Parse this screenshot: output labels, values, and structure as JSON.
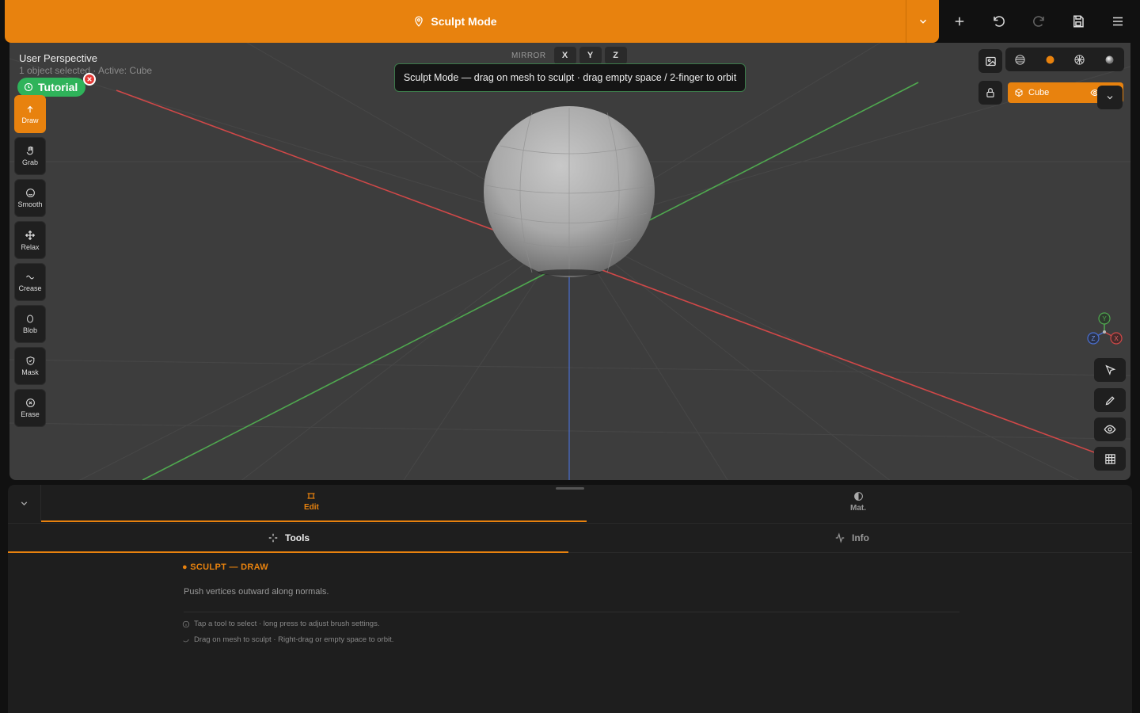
{
  "topbar": {
    "mode_label": "Sculpt Mode",
    "icons": [
      "chevron-down-icon",
      "plus-icon",
      "undo-icon",
      "redo-icon",
      "save-icon",
      "menu-icon"
    ]
  },
  "viewport": {
    "title": "User Perspective",
    "subtitle": "1 object selected · Active: Cube",
    "tutorial_label": "Tutorial",
    "toast": "Sculpt Mode — drag on mesh to sculpt · drag empty space / 2-finger to orbit",
    "mirror": {
      "label": "MIRROR",
      "axes": [
        "X",
        "Y",
        "Z"
      ]
    },
    "object_name": "Cube",
    "gizmo": {
      "y": "Y",
      "z": "Z",
      "x": "X"
    }
  },
  "tools": [
    {
      "label": "Draw",
      "icon": "arrow-up-icon",
      "active": true
    },
    {
      "label": "Grab",
      "icon": "hand-icon",
      "active": false
    },
    {
      "label": "Smooth",
      "icon": "smooth-icon",
      "active": false
    },
    {
      "label": "Relax",
      "icon": "move-icon",
      "active": false
    },
    {
      "label": "Crease",
      "icon": "wave-icon",
      "active": false
    },
    {
      "label": "Blob",
      "icon": "blob-icon",
      "active": false
    },
    {
      "label": "Mask",
      "icon": "shield-icon",
      "active": false
    },
    {
      "label": "Erase",
      "icon": "erase-icon",
      "active": false
    }
  ],
  "panel": {
    "tabs": [
      {
        "label": "Edit",
        "active": true
      },
      {
        "label": "Mat.",
        "active": false
      }
    ],
    "subtabs": [
      {
        "label": "Tools",
        "active": true
      },
      {
        "label": "Info",
        "active": false
      }
    ],
    "section_title": "● SCULPT — DRAW",
    "section_desc": "Push vertices outward along normals.",
    "hint1": "Tap a tool to select · long press to adjust brush settings.",
    "hint2": "Drag on mesh to sculpt · Right-drag or empty space to orbit."
  },
  "colors": {
    "accent": "#e8820e",
    "viewport_bg": "#3d3d3d",
    "axis_x": "#d04848",
    "axis_y": "#4fa84f",
    "axis_z": "#4a6fd0",
    "tutorial": "#2fb35a"
  }
}
